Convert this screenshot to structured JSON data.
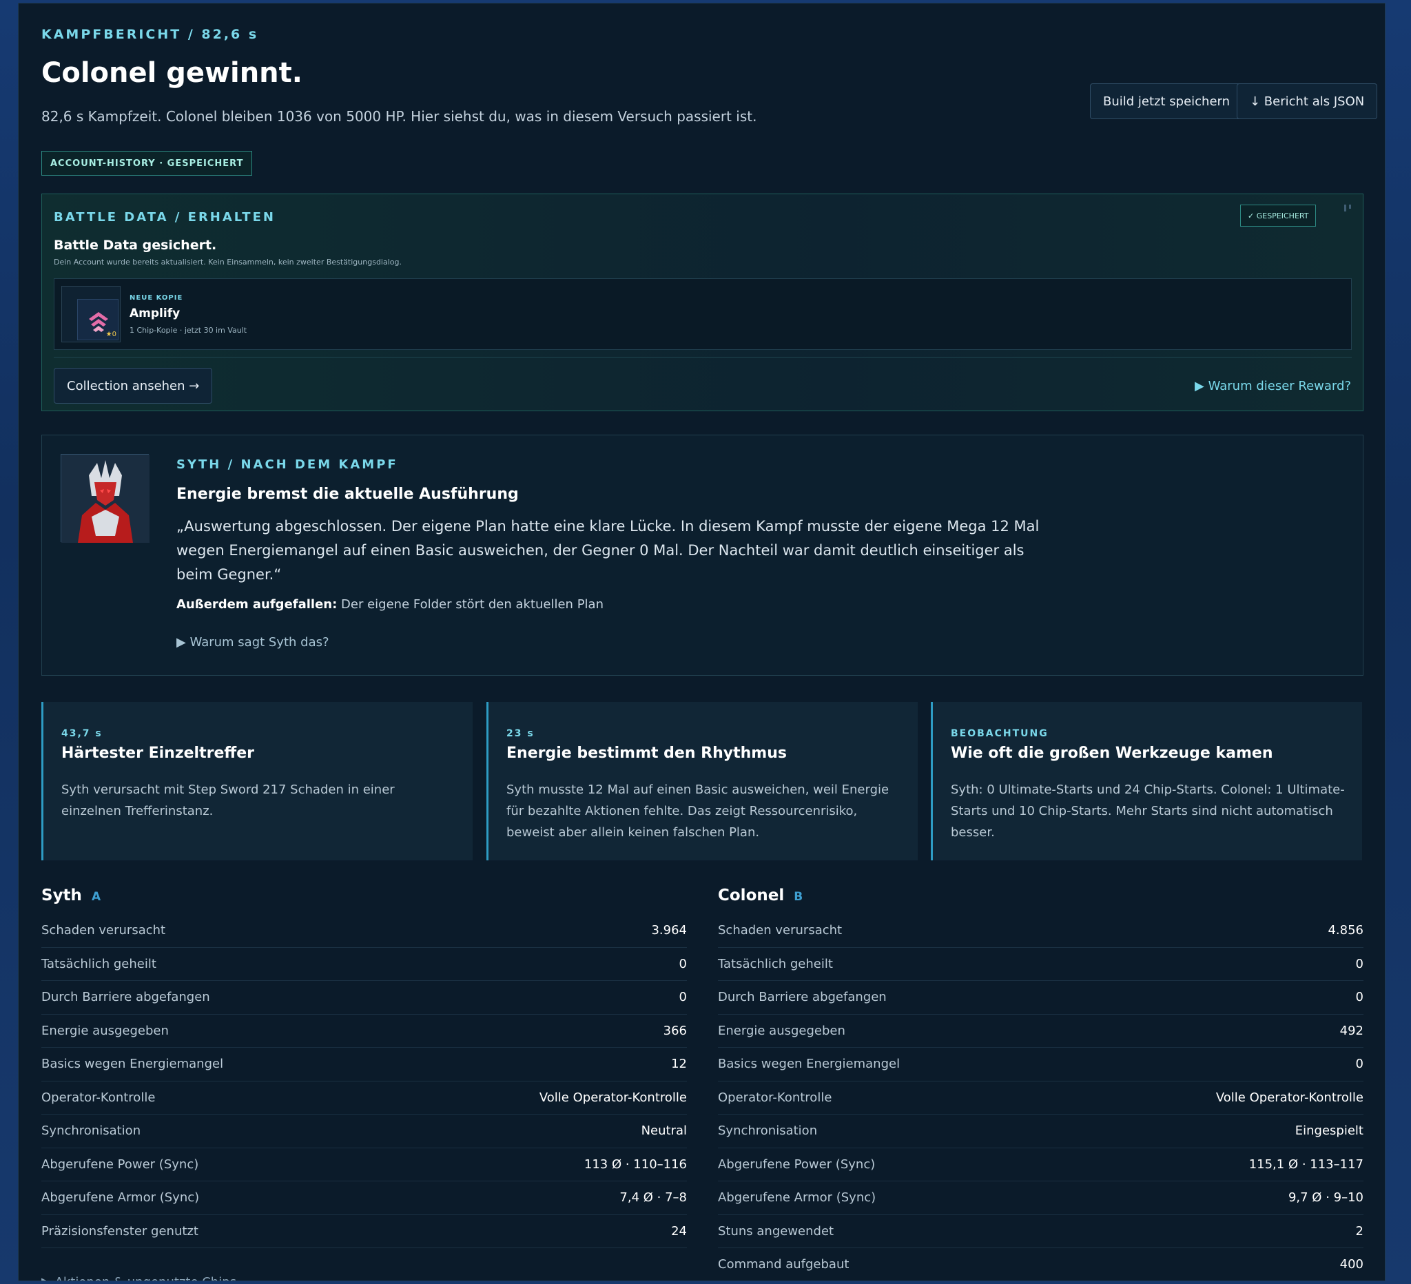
{
  "header": {
    "kicker": "KAMPFBERICHT / 82,6 s",
    "title": "Colonel gewinnt.",
    "subtitle": "82,6 s Kampfzeit. Colonel bleiben 1036 von 5000 HP. Hier siehst du, was in diesem Versuch passiert ist.",
    "save_button": "Build jetzt speichern",
    "json_button": "↓ Bericht als JSON",
    "history_badge": "ACCOUNT-HISTORY · GESPEICHERT"
  },
  "battle_data": {
    "kicker": "BATTLE DATA / ERHALTEN",
    "title": "Battle Data gesichert.",
    "note": "Dein Account wurde bereits aktualisiert. Kein Einsammeln, kein zweiter Bestätigungsdialog.",
    "saved_badge": "✓ GESPEICHERT",
    "reward": {
      "kicker": "NEUE KOPIE",
      "name": "Amplify",
      "sub": "1 Chip-Kopie · jetzt 30 im Vault",
      "stars": "★0"
    },
    "collection_button": "Collection ansehen →",
    "why_reward": "▶ Warum dieser Reward?"
  },
  "syth": {
    "kicker": "SYTH / NACH DEM KAMPF",
    "title": "Energie bremst die aktuelle Ausführung",
    "quote": "„Auswertung abgeschlossen. Der eigene Plan hatte eine klare Lücke. In diesem Kampf musste der eigene Mega 12 Mal wegen Energiemangel auf einen Basic ausweichen, der Gegner 0 Mal. Der Nachteil war damit deutlich einseitiger als beim Gegner.“",
    "also_label": "Außerdem aufgefallen:",
    "also_text": " Der eigene Folder stört den aktuellen Plan",
    "why": "▶ Warum sagt Syth das?"
  },
  "cards": [
    {
      "kicker": "43,7 s",
      "title": "Härtester Einzeltreffer",
      "text": "Syth verursacht mit Step Sword 217 Schaden in einer einzelnen Trefferinstanz."
    },
    {
      "kicker": "23 s",
      "title": "Energie bestimmt den Rhythmus",
      "text": "Syth musste 12 Mal auf einen Basic ausweichen, weil Energie für bezahlte Aktionen fehlte. Das zeigt Ressourcenrisiko, beweist aber allein keinen falschen Plan."
    },
    {
      "kicker": "BEOBACHTUNG",
      "title": "Wie oft die großen Werkzeuge kamen",
      "text": "Syth: 0 Ultimate-Starts und 24 Chip-Starts. Colonel: 1 Ultimate-Starts und 10 Chip-Starts. Mehr Starts sind nicht automatisch besser."
    }
  ],
  "stats_a": {
    "name": "Syth",
    "tag": "A",
    "rows": [
      {
        "label": "Schaden verursacht",
        "value": "3.964"
      },
      {
        "label": "Tatsächlich geheilt",
        "value": "0"
      },
      {
        "label": "Durch Barriere abgefangen",
        "value": "0"
      },
      {
        "label": "Energie ausgegeben",
        "value": "366"
      },
      {
        "label": "Basics wegen Energiemangel",
        "value": "12"
      },
      {
        "label": "Operator-Kontrolle",
        "value": "Volle Operator-Kontrolle"
      },
      {
        "label": "Synchronisation",
        "value": "Neutral"
      },
      {
        "label": "Abgerufene Power (Sync)",
        "value": "113 Ø · 110–116"
      },
      {
        "label": "Abgerufene Armor (Sync)",
        "value": "7,4 Ø · 7–8"
      },
      {
        "label": "Präzisionsfenster genutzt",
        "value": "24"
      }
    ],
    "more": "▶ Aktionen & ungenutzte Chips"
  },
  "stats_b": {
    "name": "Colonel",
    "tag": "B",
    "rows": [
      {
        "label": "Schaden verursacht",
        "value": "4.856"
      },
      {
        "label": "Tatsächlich geheilt",
        "value": "0"
      },
      {
        "label": "Durch Barriere abgefangen",
        "value": "0"
      },
      {
        "label": "Energie ausgegeben",
        "value": "492"
      },
      {
        "label": "Basics wegen Energiemangel",
        "value": "0"
      },
      {
        "label": "Operator-Kontrolle",
        "value": "Volle Operator-Kontrolle"
      },
      {
        "label": "Synchronisation",
        "value": "Eingespielt"
      },
      {
        "label": "Abgerufene Power (Sync)",
        "value": "115,1 Ø · 113–117"
      },
      {
        "label": "Abgerufene Armor (Sync)",
        "value": "9,7 Ø · 9–10"
      },
      {
        "label": "Stuns angewendet",
        "value": "2"
      },
      {
        "label": "Command aufgebaut",
        "value": "400"
      }
    ]
  }
}
